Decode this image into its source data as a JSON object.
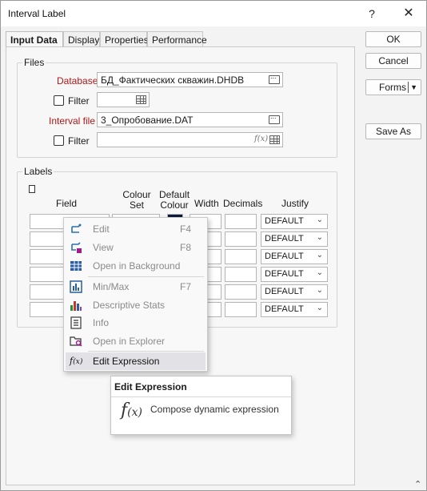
{
  "window": {
    "title": "Interval Label",
    "help": "?",
    "close": "✕"
  },
  "tabs": [
    {
      "label": "Input Data"
    },
    {
      "label": "Display"
    },
    {
      "label": "Properties"
    },
    {
      "label": "Performance"
    }
  ],
  "buttons": {
    "ok": "OK",
    "cancel": "Cancel",
    "forms": "Forms",
    "forms_arrow": "▼",
    "save_as": "Save As"
  },
  "files": {
    "title": "Files",
    "database_label": "Database",
    "database_value": "БД_Фактических скважин.DHDB",
    "filter_label": "Filter",
    "interval_file_label": "Interval file",
    "interval_file_value": "3_Опробование.DAT",
    "filter2_label": "Filter",
    "fx": "f(x)"
  },
  "labels": {
    "title": "Labels",
    "columns": {
      "field": "Field",
      "colour_set_1": "Colour",
      "colour_set_2": "Set",
      "default_colour_1": "Default",
      "default_colour_2": "Colour",
      "width": "Width",
      "decimals": "Decimals",
      "justify": "Justify"
    },
    "justify_values": [
      "DEFAULT",
      "DEFAULT",
      "DEFAULT",
      "DEFAULT",
      "DEFAULT",
      "DEFAULT"
    ]
  },
  "context_menu": {
    "items": [
      {
        "label": "Edit",
        "shortcut": "F4",
        "icon": "edit-icon"
      },
      {
        "label": "View",
        "shortcut": "F8",
        "icon": "view-icon"
      },
      {
        "label": "Open in Background",
        "shortcut": "",
        "icon": "table-icon"
      },
      {
        "label": "Min/Max",
        "shortcut": "F7",
        "icon": "minmax-icon"
      },
      {
        "label": "Descriptive Stats",
        "shortcut": "",
        "icon": "stats-icon"
      },
      {
        "label": "Info",
        "shortcut": "",
        "icon": "info-icon"
      },
      {
        "label": "Open in Explorer",
        "shortcut": "",
        "icon": "explorer-icon"
      },
      {
        "label": "Edit Expression",
        "shortcut": "",
        "icon": "fx-icon"
      }
    ]
  },
  "tooltip": {
    "title": "Edit Expression",
    "fx_main": "f",
    "fx_sub": "(x)",
    "text": "Compose dynamic expression"
  }
}
